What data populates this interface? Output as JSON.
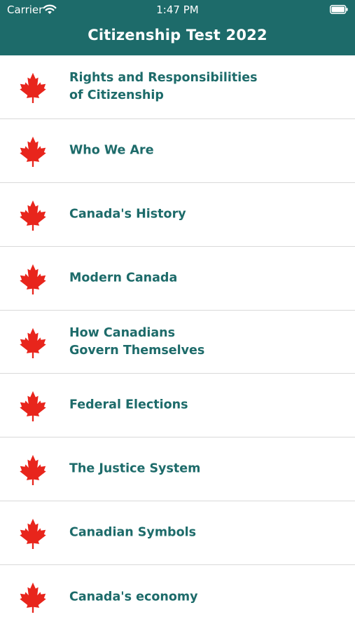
{
  "status_bar": {
    "carrier": "Carrier",
    "time": "1:47 PM"
  },
  "header": {
    "title": "Citizenship Test 2022"
  },
  "colors": {
    "header_bg": "#1d6b6a",
    "label_text": "#1d6b6a",
    "leaf": "#e8251c"
  },
  "topics": [
    {
      "label": "Rights and Responsibilities\nof Citizenship",
      "icon": "maple-leaf-icon"
    },
    {
      "label": "Who We Are",
      "icon": "maple-leaf-icon"
    },
    {
      "label": "Canada's History",
      "icon": "maple-leaf-icon"
    },
    {
      "label": "Modern Canada",
      "icon": "maple-leaf-icon"
    },
    {
      "label": "How Canadians\nGovern Themselves",
      "icon": "maple-leaf-icon"
    },
    {
      "label": "Federal Elections",
      "icon": "maple-leaf-icon"
    },
    {
      "label": "The Justice System",
      "icon": "maple-leaf-icon"
    },
    {
      "label": "Canadian Symbols",
      "icon": "maple-leaf-icon"
    },
    {
      "label": "Canada's economy",
      "icon": "maple-leaf-icon"
    }
  ]
}
